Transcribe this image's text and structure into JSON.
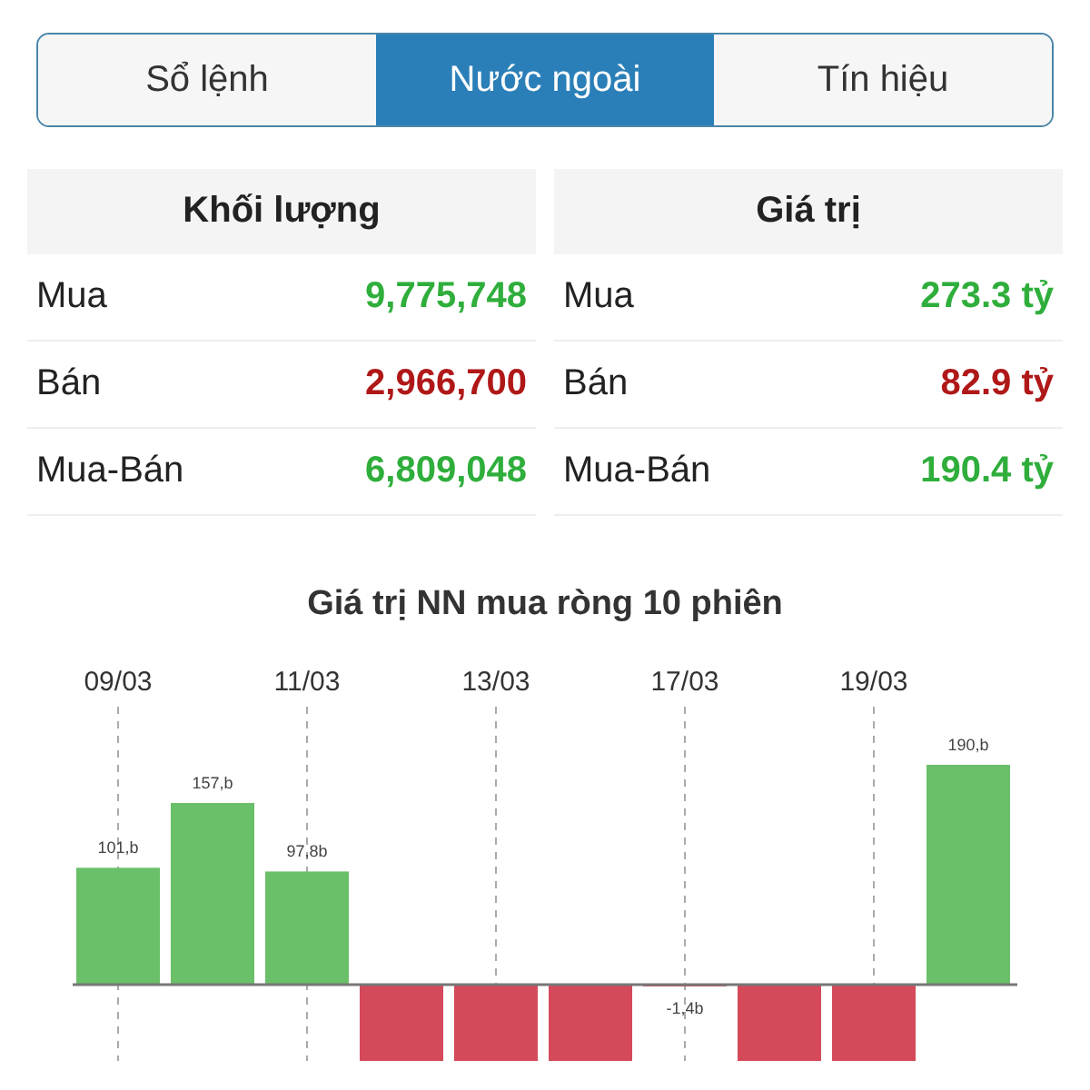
{
  "tabs": [
    {
      "label": "Sổ lệnh",
      "selected": false
    },
    {
      "label": "Nước ngoài",
      "selected": true
    },
    {
      "label": "Tín hiệu",
      "selected": false
    }
  ],
  "tables": [
    {
      "heading": "Khối lượng",
      "rows": [
        {
          "label": "Mua",
          "value": "9,775,748",
          "kind": "up"
        },
        {
          "label": "Bán",
          "value": "2,966,700",
          "kind": "down"
        },
        {
          "label": "Mua-Bán",
          "value": "6,809,048",
          "kind": "up"
        }
      ]
    },
    {
      "heading": "Giá trị",
      "rows": [
        {
          "label": "Mua",
          "value": "273.3 tỷ",
          "kind": "up"
        },
        {
          "label": "Bán",
          "value": "82.9 tỷ",
          "kind": "down"
        },
        {
          "label": "Mua-Bán",
          "value": "190.4 tỷ",
          "kind": "up"
        }
      ]
    }
  ],
  "chart": {
    "chart_data": {
      "type": "bar",
      "title": "Giá trị NN mua ròng 10 phiên",
      "categories": [
        "09/03",
        null,
        "11/03",
        null,
        "13/03",
        null,
        "17/03",
        null,
        "19/03",
        null
      ],
      "values": [
        101,
        157,
        97.8,
        -66,
        -66,
        -66,
        -1.4,
        -66,
        -66,
        190
      ],
      "value_labels": [
        "101,b",
        "157,b",
        "97,8b",
        null,
        null,
        null,
        "-1,4b",
        null,
        null,
        "190,b"
      ],
      "grid": true
    }
  }
}
